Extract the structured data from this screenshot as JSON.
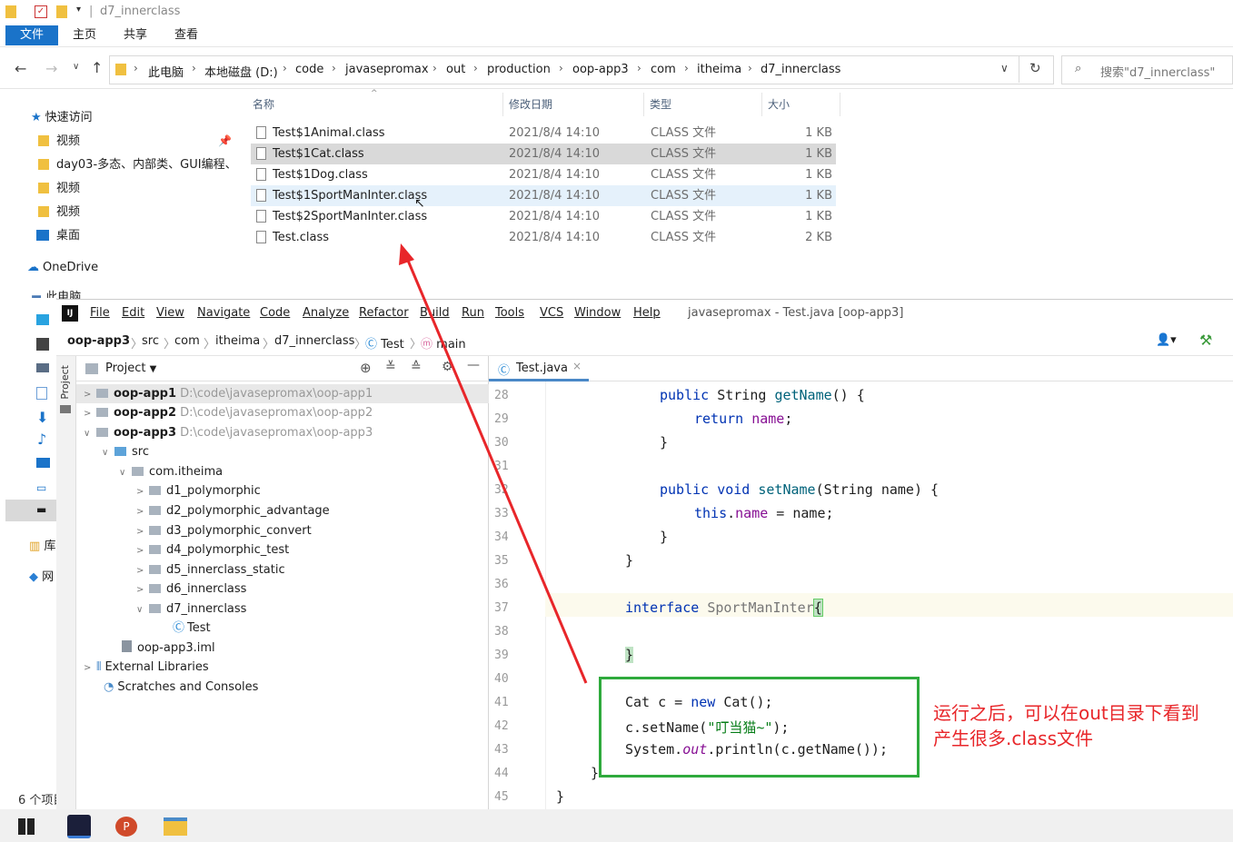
{
  "explorer": {
    "title": "d7_innerclass",
    "ribbon_tabs": [
      "文件",
      "主页",
      "共享",
      "查看"
    ],
    "breadcrumb": [
      "此电脑",
      "本地磁盘 (D:)",
      "code",
      "javasepromax",
      "out",
      "production",
      "oop-app3",
      "com",
      "itheima",
      "d7_innerclass"
    ],
    "search_placeholder": "搜索\"d7_innerclass\"",
    "nav": {
      "quick_access": "快速访问",
      "items": [
        "视频",
        "day03-多态、内部类、GUI编程、",
        "视频",
        "视频",
        "桌面"
      ],
      "onedrive": "OneDrive",
      "this_pc": "此电脑",
      "lib": "库",
      "network": "网"
    },
    "columns": {
      "name": "名称",
      "date": "修改日期",
      "type": "类型",
      "size": "大小"
    },
    "files": [
      {
        "name": "Test$1Animal.class",
        "date": "2021/8/4 14:10",
        "type": "CLASS 文件",
        "size": "1 KB"
      },
      {
        "name": "Test$1Cat.class",
        "date": "2021/8/4 14:10",
        "type": "CLASS 文件",
        "size": "1 KB"
      },
      {
        "name": "Test$1Dog.class",
        "date": "2021/8/4 14:10",
        "type": "CLASS 文件",
        "size": "1 KB"
      },
      {
        "name": "Test$1SportManInter.class",
        "date": "2021/8/4 14:10",
        "type": "CLASS 文件",
        "size": "1 KB"
      },
      {
        "name": "Test$2SportManInter.class",
        "date": "2021/8/4 14:10",
        "type": "CLASS 文件",
        "size": "1 KB"
      },
      {
        "name": "Test.class",
        "date": "2021/8/4 14:10",
        "type": "CLASS 文件",
        "size": "2 KB"
      }
    ],
    "status": "6 个项目"
  },
  "ide": {
    "menu": [
      "File",
      "Edit",
      "View",
      "Navigate",
      "Code",
      "Analyze",
      "Refactor",
      "Build",
      "Run",
      "Tools",
      "VCS",
      "Window",
      "Help"
    ],
    "window_title": "javasepromax - Test.java [oop-app3]",
    "breadcrumb": [
      "oop-app3",
      "src",
      "com",
      "itheima",
      "d7_innerclass",
      "Test",
      "main"
    ],
    "project_label": "Project",
    "side_label": "Project",
    "tab": "Test.java",
    "tree": [
      {
        "label": "oop-app1",
        "path": "D:\\code\\javasepromax\\oop-app1"
      },
      {
        "label": "oop-app2",
        "path": "D:\\code\\javasepromax\\oop-app2"
      },
      {
        "label": "oop-app3",
        "path": "D:\\code\\javasepromax\\oop-app3"
      },
      {
        "label": "src"
      },
      {
        "label": "com.itheima"
      },
      {
        "label": "d1_polymorphic"
      },
      {
        "label": "d2_polymorphic_advantage"
      },
      {
        "label": "d3_polymorphic_convert"
      },
      {
        "label": "d4_polymorphic_test"
      },
      {
        "label": "d5_innerclass_static"
      },
      {
        "label": "d6_innerclass"
      },
      {
        "label": "d7_innerclass"
      },
      {
        "label": "Test"
      },
      {
        "label": "oop-app3.iml"
      },
      {
        "label": "External Libraries"
      },
      {
        "label": "Scratches and Consoles"
      }
    ],
    "line_numbers": [
      "28",
      "29",
      "30",
      "31",
      "32",
      "33",
      "34",
      "35",
      "36",
      "37",
      "38",
      "39",
      "40",
      "41",
      "42",
      "43",
      "44",
      "45"
    ]
  },
  "annotation": {
    "line1": "运行之后，可以在out目录下看到",
    "line2": "产生很多.class文件"
  },
  "colors": {
    "accent": "#1a73c9",
    "annotation": "#e8262a",
    "box": "#2eaa3c",
    "selected_row": "#d9d9d9",
    "hover_row": "#e5f1fb"
  }
}
